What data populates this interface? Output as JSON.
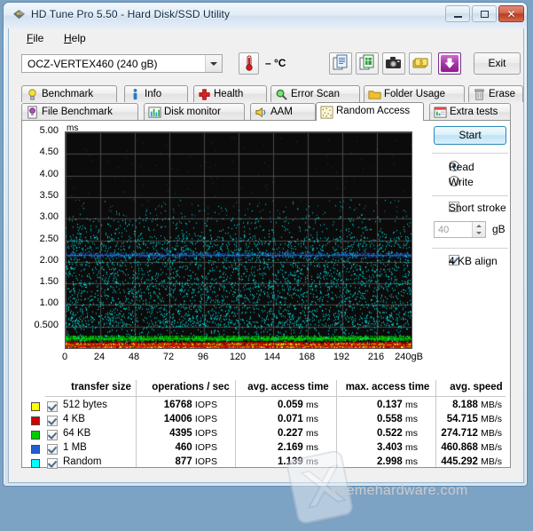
{
  "window": {
    "title": "HD Tune Pro 5.50 - Hard Disk/SSD Utility",
    "minimize_label": "–",
    "maximize_label": "□",
    "close_label": "✕"
  },
  "menu": {
    "file": "File",
    "help": "Help"
  },
  "toolbar": {
    "drive": "OCZ-VERTEX460 (240 gB)",
    "temperature": "– °C",
    "exit_label": "Exit",
    "icons": [
      "copy-to-clipboard-icon",
      "copy-to-excel-icon",
      "screenshot-camera-icon",
      "donate-money-icon",
      "download-arrow-icon"
    ]
  },
  "tabs": {
    "row1": [
      {
        "label": "Benchmark",
        "icon": "lightbulb-icon",
        "active": false
      },
      {
        "label": "Info",
        "icon": "info-icon",
        "active": false
      },
      {
        "label": "Health",
        "icon": "red-cross-icon",
        "active": false
      },
      {
        "label": "Error Scan",
        "icon": "magnifier-icon",
        "active": false
      },
      {
        "label": "Folder Usage",
        "icon": "folder-icon",
        "active": false
      },
      {
        "label": "Erase",
        "icon": "trash-icon",
        "active": false
      }
    ],
    "row2": [
      {
        "label": "File Benchmark",
        "icon": "file-benchmark-icon",
        "active": false
      },
      {
        "label": "Disk monitor",
        "icon": "bar-chart-icon",
        "active": false
      },
      {
        "label": "AAM",
        "icon": "speaker-icon",
        "active": false
      },
      {
        "label": "Random Access",
        "icon": "random-access-icon",
        "active": true
      },
      {
        "label": "Extra tests",
        "icon": "extra-tests-icon",
        "active": false
      }
    ]
  },
  "controls": {
    "start_label": "Start",
    "read_label": "Read",
    "write_label": "Write",
    "read_selected": true,
    "short_stroke_label": "Short stroke",
    "short_stroke_checked": false,
    "short_stroke_value": "40",
    "short_stroke_unit": "gB",
    "align_label": "4 KB align",
    "align_checked": true
  },
  "chart_data": {
    "type": "scatter",
    "title": "",
    "ylabel": "ms",
    "xlabel": "240gB",
    "ylim": [
      0,
      5.0
    ],
    "xlim": [
      0,
      240
    ],
    "yticks": [
      "0.500",
      "1.00",
      "1.50",
      "2.00",
      "2.50",
      "3.00",
      "3.50",
      "4.00",
      "4.50",
      "5.00"
    ],
    "ytick_values": [
      0.5,
      1.0,
      1.5,
      2.0,
      2.5,
      3.0,
      3.5,
      4.0,
      4.5,
      5.0
    ],
    "xticks": [
      "0",
      "24",
      "48",
      "72",
      "96",
      "120",
      "144",
      "168",
      "192",
      "216",
      "240gB"
    ],
    "xtick_values": [
      0,
      24,
      48,
      72,
      96,
      120,
      144,
      168,
      192,
      216,
      240
    ],
    "grid": true,
    "background": "#0b0b0b",
    "gridcolor": "#4a4a4a",
    "legend_position": "table-below",
    "series": [
      {
        "name": "512 bytes",
        "color": "#ffff00",
        "mean_ms": 0.059,
        "max_ms": 0.137,
        "band": true
      },
      {
        "name": "4 KB",
        "color": "#cc0000",
        "mean_ms": 0.071,
        "max_ms": 0.558,
        "band": true
      },
      {
        "name": "64 KB",
        "color": "#00cc00",
        "mean_ms": 0.227,
        "max_ms": 0.522,
        "band": true
      },
      {
        "name": "1 MB",
        "color": "#1f5fd0",
        "mean_ms": 2.169,
        "max_ms": 3.403,
        "band": true
      },
      {
        "name": "Random",
        "color": "#00ffff",
        "mean_ms": 1.139,
        "max_ms": 2.998,
        "band": false
      }
    ]
  },
  "table": {
    "headers": [
      "transfer size",
      "operations / sec",
      "avg. access time",
      "max. access time",
      "avg. speed"
    ],
    "rows": [
      {
        "color": "#ffff00",
        "checked": true,
        "size": "512 bytes",
        "iops": "16768",
        "iops_unit": "IOPS",
        "avg": "0.059",
        "avg_unit": "ms",
        "max": "0.137",
        "max_unit": "ms",
        "speed": "8.188",
        "speed_unit": "MB/s"
      },
      {
        "color": "#cc0000",
        "checked": true,
        "size": "4 KB",
        "iops": "14006",
        "iops_unit": "IOPS",
        "avg": "0.071",
        "avg_unit": "ms",
        "max": "0.558",
        "max_unit": "ms",
        "speed": "54.715",
        "speed_unit": "MB/s"
      },
      {
        "color": "#00cc00",
        "checked": true,
        "size": "64 KB",
        "iops": "4395",
        "iops_unit": "IOPS",
        "avg": "0.227",
        "avg_unit": "ms",
        "max": "0.522",
        "max_unit": "ms",
        "speed": "274.712",
        "speed_unit": "MB/s"
      },
      {
        "color": "#1f5fd0",
        "checked": true,
        "size": "1 MB",
        "iops": "460",
        "iops_unit": "IOPS",
        "avg": "2.169",
        "avg_unit": "ms",
        "max": "3.403",
        "max_unit": "ms",
        "speed": "460.868",
        "speed_unit": "MB/s"
      },
      {
        "color": "#00ffff",
        "checked": true,
        "size": "Random",
        "iops": "877",
        "iops_unit": "IOPS",
        "avg": "1.139",
        "avg_unit": "ms",
        "max": "2.998",
        "max_unit": "ms",
        "speed": "445.292",
        "speed_unit": "MB/s"
      }
    ]
  },
  "watermark": {
    "text": "xtremehardware.com"
  }
}
